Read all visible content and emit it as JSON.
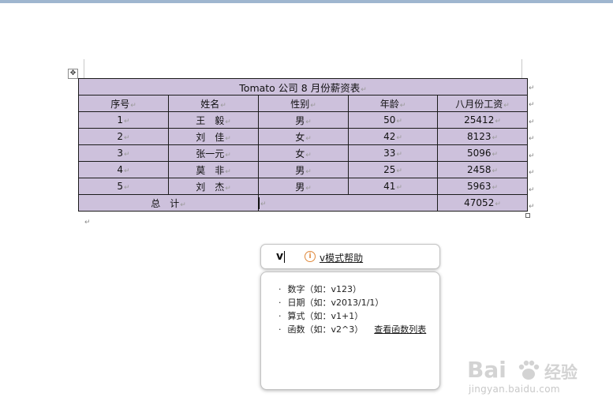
{
  "table": {
    "title": "Tomato 公司 8 月份薪资表",
    "headers": [
      "序号",
      "姓名",
      "性别",
      "年龄",
      "八月份工资"
    ],
    "rows": [
      [
        "1",
        "王　毅",
        "男",
        "50",
        "25412"
      ],
      [
        "2",
        "刘　佳",
        "女",
        "42",
        "8123"
      ],
      [
        "3",
        "张一元",
        "女",
        "33",
        "5096"
      ],
      [
        "4",
        "莫　非",
        "男",
        "25",
        "2458"
      ],
      [
        "5",
        "刘　杰",
        "男",
        "41",
        "5963"
      ]
    ],
    "total_label": "总　计",
    "total_value": "47052"
  },
  "marks": {
    "paragraph": "↵",
    "cell_end": "↵",
    "move_handle": "✥"
  },
  "vmode": {
    "input_value": "v",
    "help_link": "v模式帮助",
    "info_icon": "i",
    "items": [
      "数字（如：v123）",
      "日期（如：v2013/1/1）",
      "算式（如：v1+1）",
      "函数（如：v2^3）"
    ],
    "function_link": "查看函数列表"
  },
  "watermark": {
    "brand_left": "Bai",
    "brand_right": "经验",
    "url": "jingyan.baidu.com"
  }
}
